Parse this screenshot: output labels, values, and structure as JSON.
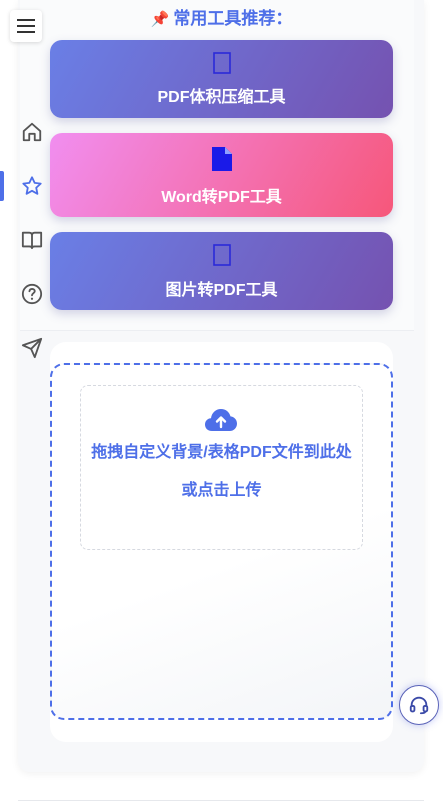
{
  "recommend": {
    "pin_icon": "pushpin-icon",
    "title": "常用工具推荐："
  },
  "tools": [
    {
      "label": "PDF体积压缩工具",
      "icon": "compress-icon"
    },
    {
      "label": "Word转PDF工具",
      "icon": "file-icon"
    },
    {
      "label": "图片转PDF工具",
      "icon": "image-icon"
    }
  ],
  "sidebar": {
    "items": [
      {
        "name": "home",
        "icon": "home-icon"
      },
      {
        "name": "favorites",
        "icon": "star-icon",
        "active": true
      },
      {
        "name": "guide",
        "icon": "book-icon"
      },
      {
        "name": "help",
        "icon": "help-circle-icon"
      },
      {
        "name": "send",
        "icon": "send-icon"
      }
    ]
  },
  "upload": {
    "icon": "cloud-upload-icon",
    "line1": "拖拽自定义背景/表格PDF文件到此处",
    "line2": "或点击上传"
  },
  "support": {
    "icon": "headset-icon"
  },
  "colors": {
    "accent": "#4e6fe8",
    "card_blue_start": "#6a7fe6",
    "card_blue_end": "#7552b0",
    "card_pink_start": "#f18ef0",
    "card_pink_end": "#f6577a"
  }
}
